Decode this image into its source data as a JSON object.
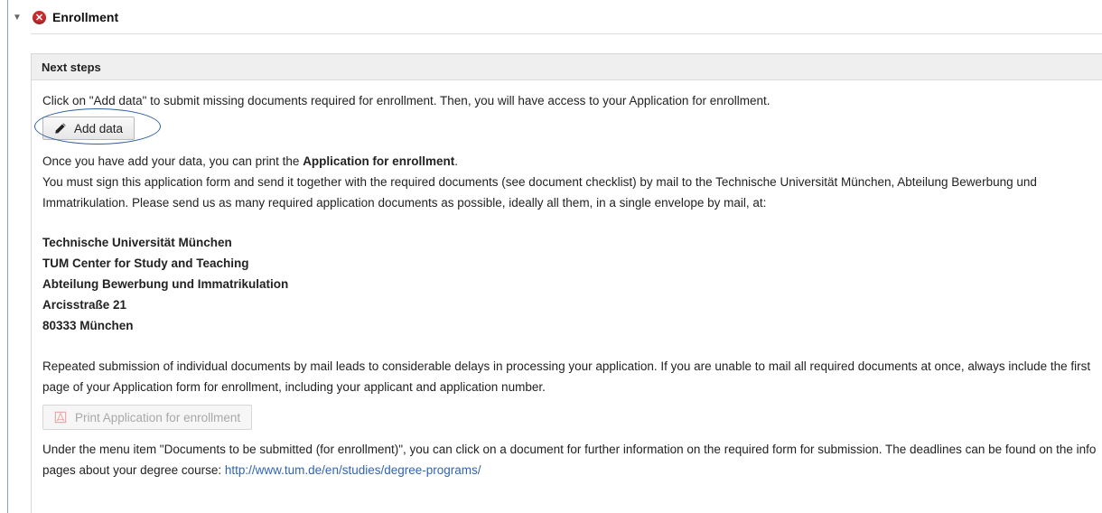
{
  "section": {
    "toggle_glyph": "▼",
    "status_icon": "error-icon",
    "status_glyph": "✕",
    "title": "Enrollment"
  },
  "panel": {
    "header": "Next steps",
    "intro": "Click on \"Add data\" to submit missing documents required for enrollment. Then, you will have access to your Application for enrollment.",
    "add_button_label": "Add data",
    "print_text_before": "Once you have add your data, you can print the ",
    "print_text_bold": "Application for enrollment",
    "print_text_after": ".",
    "sign_text": "You must sign this application form and send it together with the required documents (see document checklist) by mail to the Technische Universität München, Abteilung Bewerbung und Immatrikulation. Please send us as many required application documents as possible, ideally all them, in a single envelope by mail, at:",
    "address": [
      "Technische Universität München",
      "TUM Center for Study and Teaching",
      "Abteilung Bewerbung und Immatrikulation",
      "Arcisstraße 21",
      "80333 München"
    ],
    "repeat_text": "Repeated submission of individual documents by mail leads to considerable delays in processing your application. If you are unable to mail all required documents at once, always include the first page of your Application form for enrollment, including your applicant and application number.",
    "print_button_label": "Print Application for enrollment",
    "menu_text": "Under the menu item \"Documents to be submitted (for enrollment)\", you can click on a document for further information on the required form for submission. The deadlines can be found on the info pages about your degree course: ",
    "menu_link": "http://www.tum.de/en/studies/degree-programs/"
  },
  "colors": {
    "error_red": "#cc2b2b",
    "link_blue": "#2f65b0",
    "highlight_blue": "#2e5f9e"
  }
}
